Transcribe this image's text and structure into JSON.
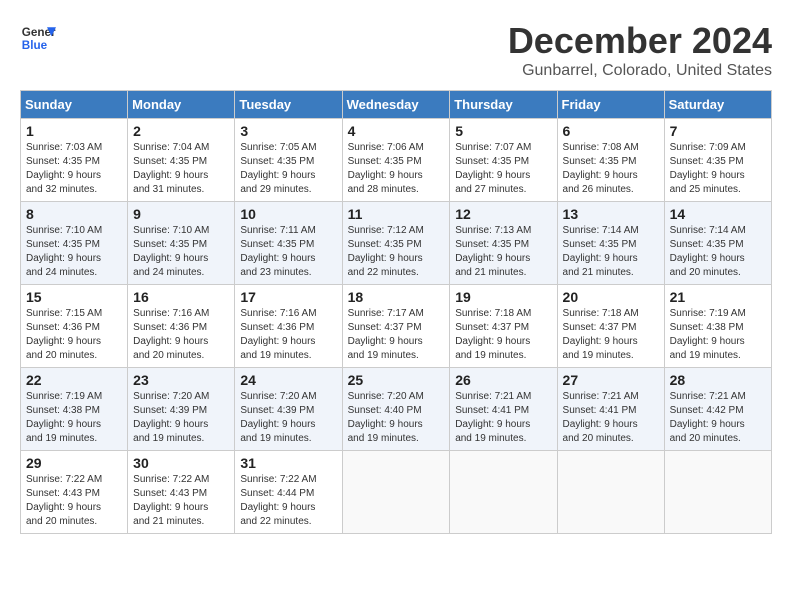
{
  "logo": {
    "line1": "General",
    "line2": "Blue"
  },
  "title": "December 2024",
  "subtitle": "Gunbarrel, Colorado, United States",
  "weekdays": [
    "Sunday",
    "Monday",
    "Tuesday",
    "Wednesday",
    "Thursday",
    "Friday",
    "Saturday"
  ],
  "weeks": [
    [
      {
        "day": "1",
        "info": "Sunrise: 7:03 AM\nSunset: 4:35 PM\nDaylight: 9 hours\nand 32 minutes."
      },
      {
        "day": "2",
        "info": "Sunrise: 7:04 AM\nSunset: 4:35 PM\nDaylight: 9 hours\nand 31 minutes."
      },
      {
        "day": "3",
        "info": "Sunrise: 7:05 AM\nSunset: 4:35 PM\nDaylight: 9 hours\nand 29 minutes."
      },
      {
        "day": "4",
        "info": "Sunrise: 7:06 AM\nSunset: 4:35 PM\nDaylight: 9 hours\nand 28 minutes."
      },
      {
        "day": "5",
        "info": "Sunrise: 7:07 AM\nSunset: 4:35 PM\nDaylight: 9 hours\nand 27 minutes."
      },
      {
        "day": "6",
        "info": "Sunrise: 7:08 AM\nSunset: 4:35 PM\nDaylight: 9 hours\nand 26 minutes."
      },
      {
        "day": "7",
        "info": "Sunrise: 7:09 AM\nSunset: 4:35 PM\nDaylight: 9 hours\nand 25 minutes."
      }
    ],
    [
      {
        "day": "8",
        "info": "Sunrise: 7:10 AM\nSunset: 4:35 PM\nDaylight: 9 hours\nand 24 minutes."
      },
      {
        "day": "9",
        "info": "Sunrise: 7:10 AM\nSunset: 4:35 PM\nDaylight: 9 hours\nand 24 minutes."
      },
      {
        "day": "10",
        "info": "Sunrise: 7:11 AM\nSunset: 4:35 PM\nDaylight: 9 hours\nand 23 minutes."
      },
      {
        "day": "11",
        "info": "Sunrise: 7:12 AM\nSunset: 4:35 PM\nDaylight: 9 hours\nand 22 minutes."
      },
      {
        "day": "12",
        "info": "Sunrise: 7:13 AM\nSunset: 4:35 PM\nDaylight: 9 hours\nand 21 minutes."
      },
      {
        "day": "13",
        "info": "Sunrise: 7:14 AM\nSunset: 4:35 PM\nDaylight: 9 hours\nand 21 minutes."
      },
      {
        "day": "14",
        "info": "Sunrise: 7:14 AM\nSunset: 4:35 PM\nDaylight: 9 hours\nand 20 minutes."
      }
    ],
    [
      {
        "day": "15",
        "info": "Sunrise: 7:15 AM\nSunset: 4:36 PM\nDaylight: 9 hours\nand 20 minutes."
      },
      {
        "day": "16",
        "info": "Sunrise: 7:16 AM\nSunset: 4:36 PM\nDaylight: 9 hours\nand 20 minutes."
      },
      {
        "day": "17",
        "info": "Sunrise: 7:16 AM\nSunset: 4:36 PM\nDaylight: 9 hours\nand 19 minutes."
      },
      {
        "day": "18",
        "info": "Sunrise: 7:17 AM\nSunset: 4:37 PM\nDaylight: 9 hours\nand 19 minutes."
      },
      {
        "day": "19",
        "info": "Sunrise: 7:18 AM\nSunset: 4:37 PM\nDaylight: 9 hours\nand 19 minutes."
      },
      {
        "day": "20",
        "info": "Sunrise: 7:18 AM\nSunset: 4:37 PM\nDaylight: 9 hours\nand 19 minutes."
      },
      {
        "day": "21",
        "info": "Sunrise: 7:19 AM\nSunset: 4:38 PM\nDaylight: 9 hours\nand 19 minutes."
      }
    ],
    [
      {
        "day": "22",
        "info": "Sunrise: 7:19 AM\nSunset: 4:38 PM\nDaylight: 9 hours\nand 19 minutes."
      },
      {
        "day": "23",
        "info": "Sunrise: 7:20 AM\nSunset: 4:39 PM\nDaylight: 9 hours\nand 19 minutes."
      },
      {
        "day": "24",
        "info": "Sunrise: 7:20 AM\nSunset: 4:39 PM\nDaylight: 9 hours\nand 19 minutes."
      },
      {
        "day": "25",
        "info": "Sunrise: 7:20 AM\nSunset: 4:40 PM\nDaylight: 9 hours\nand 19 minutes."
      },
      {
        "day": "26",
        "info": "Sunrise: 7:21 AM\nSunset: 4:41 PM\nDaylight: 9 hours\nand 19 minutes."
      },
      {
        "day": "27",
        "info": "Sunrise: 7:21 AM\nSunset: 4:41 PM\nDaylight: 9 hours\nand 20 minutes."
      },
      {
        "day": "28",
        "info": "Sunrise: 7:21 AM\nSunset: 4:42 PM\nDaylight: 9 hours\nand 20 minutes."
      }
    ],
    [
      {
        "day": "29",
        "info": "Sunrise: 7:22 AM\nSunset: 4:43 PM\nDaylight: 9 hours\nand 20 minutes."
      },
      {
        "day": "30",
        "info": "Sunrise: 7:22 AM\nSunset: 4:43 PM\nDaylight: 9 hours\nand 21 minutes."
      },
      {
        "day": "31",
        "info": "Sunrise: 7:22 AM\nSunset: 4:44 PM\nDaylight: 9 hours\nand 22 minutes."
      },
      {
        "day": "",
        "info": ""
      },
      {
        "day": "",
        "info": ""
      },
      {
        "day": "",
        "info": ""
      },
      {
        "day": "",
        "info": ""
      }
    ]
  ]
}
